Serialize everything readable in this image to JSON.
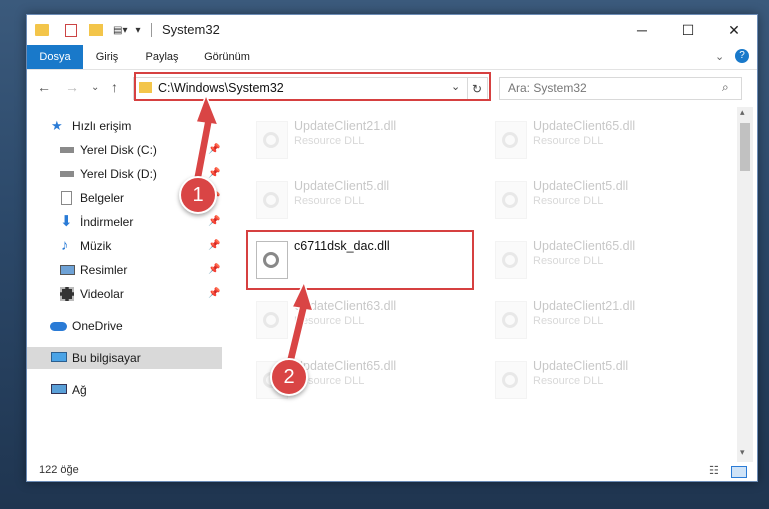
{
  "window": {
    "title": "System32",
    "controls": {
      "minimize": "─",
      "maximize": "☐",
      "close": "✕"
    }
  },
  "ribbon": {
    "tabs": [
      {
        "label": "Dosya",
        "active": true
      },
      {
        "label": "Giriş"
      },
      {
        "label": "Paylaş"
      },
      {
        "label": "Görünüm"
      }
    ],
    "help": "?"
  },
  "address": {
    "path": "C:\\Windows\\System32",
    "search_placeholder": "Ara: System32"
  },
  "sidebar": {
    "items": [
      {
        "label": "Hızlı erişim",
        "icon": "star-icon"
      },
      {
        "label": "Yerel Disk (C:)",
        "icon": "drive-icon",
        "pinned": true
      },
      {
        "label": "Yerel Disk (D:)",
        "icon": "drive-icon",
        "pinned": true
      },
      {
        "label": "Belgeler",
        "icon": "documents-icon",
        "pinned": true
      },
      {
        "label": "İndirmeler",
        "icon": "download-icon",
        "pinned": true
      },
      {
        "label": "Müzik",
        "icon": "music-icon",
        "pinned": true
      },
      {
        "label": "Resimler",
        "icon": "pictures-icon",
        "pinned": true
      },
      {
        "label": "Videolar",
        "icon": "videos-icon",
        "pinned": true
      },
      {
        "label": "OneDrive",
        "icon": "cloud-icon"
      },
      {
        "label": "Bu bilgisayar",
        "icon": "computer-icon",
        "selected": true
      },
      {
        "label": "Ağ",
        "icon": "network-icon"
      }
    ]
  },
  "files": [
    {
      "name": "UpdateClient21.dll",
      "type": "Resource DLL"
    },
    {
      "name": "UpdateClient65.dll",
      "type": "Resource DLL"
    },
    {
      "name": "UpdateClient5.dll",
      "type": "Resource DLL"
    },
    {
      "name": "UpdateClient5.dll",
      "type": "Resource DLL"
    },
    {
      "name": "c6711dsk_dac.dll",
      "type": ""
    },
    {
      "name": "UpdateClient65.dll",
      "type": "Resource DLL"
    },
    {
      "name": "UpdateClient63.dll",
      "type": "Resource DLL"
    },
    {
      "name": "UpdateClient21.dll",
      "type": "Resource DLL"
    },
    {
      "name": "UpdateClient65.dll",
      "type": "Resource DLL"
    },
    {
      "name": "UpdateClient5.dll",
      "type": "Resource DLL"
    }
  ],
  "status": {
    "count": "122 öğe"
  },
  "annotations": {
    "step1": "1",
    "step2": "2",
    "color": "#d64040"
  }
}
